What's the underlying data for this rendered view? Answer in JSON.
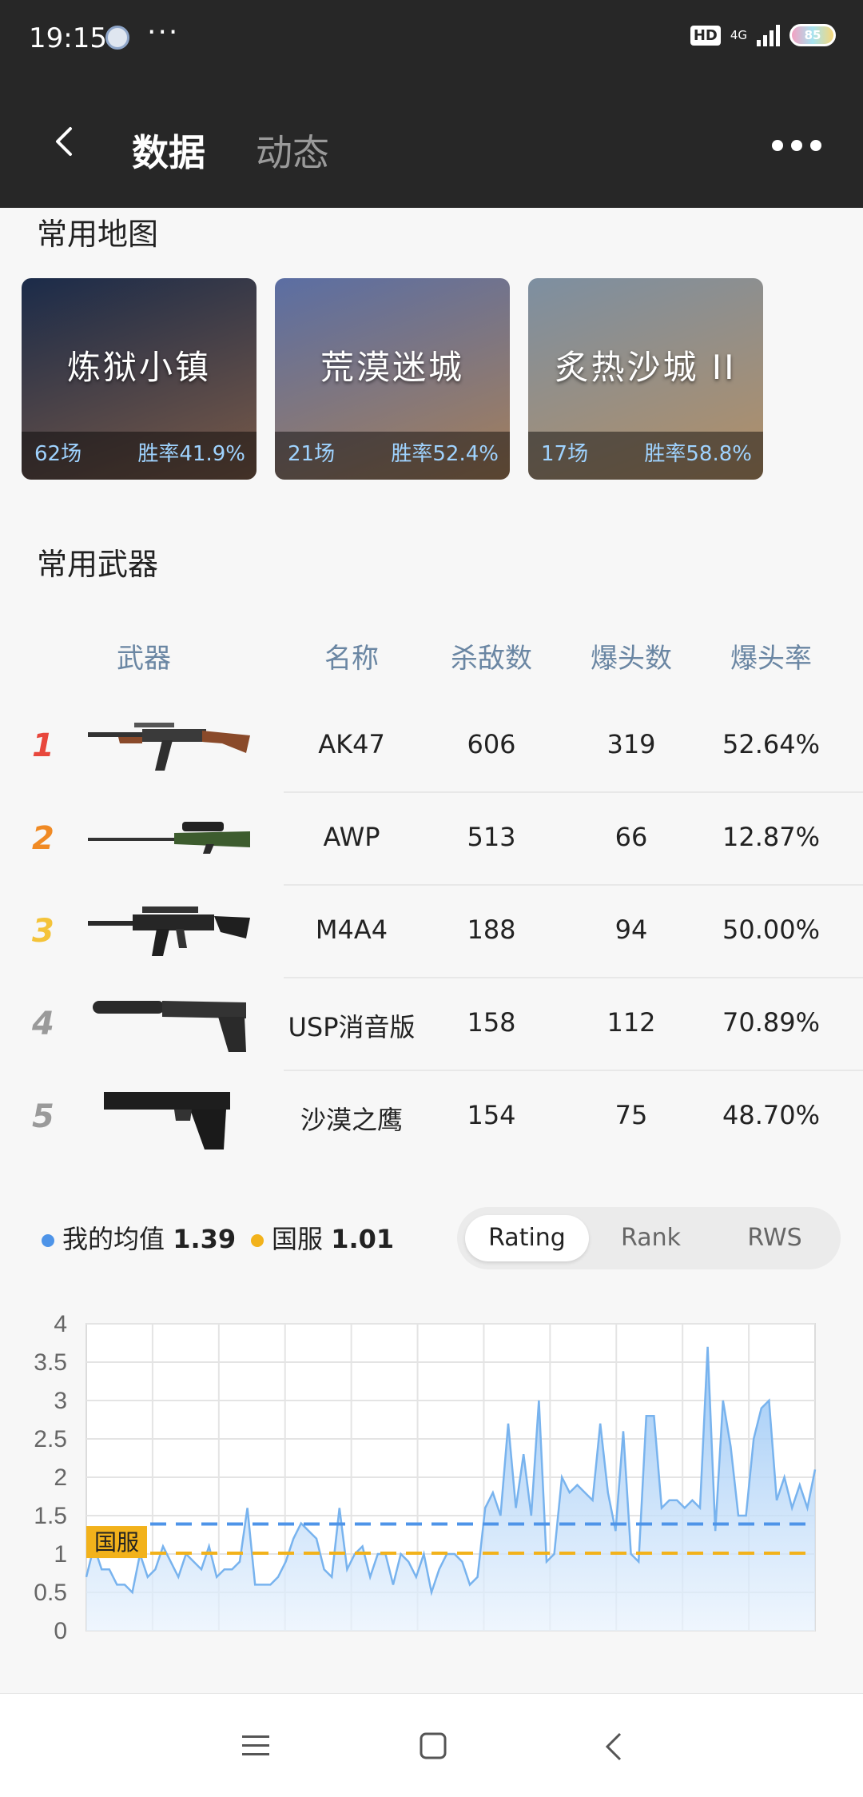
{
  "status_bar": {
    "time": "19:15",
    "more": "···",
    "hd": "HD",
    "network": "4G",
    "battery": "85"
  },
  "header": {
    "tabs": [
      {
        "label": "数据",
        "active": true
      },
      {
        "label": "动态",
        "active": false
      }
    ]
  },
  "maps_section": {
    "title": "常用地图",
    "maps": [
      {
        "name": "炼狱小镇",
        "games": "62场",
        "winrate": "胜率41.9%",
        "colors": [
          "#1b2b49",
          "#7a5a47"
        ]
      },
      {
        "name": "荒漠迷城",
        "games": "21场",
        "winrate": "胜率52.4%",
        "colors": [
          "#5b6ea3",
          "#a57f5a"
        ]
      },
      {
        "name": "炙热沙城 II",
        "games": "17场",
        "winrate": "胜率58.8%",
        "colors": [
          "#7d8fa1",
          "#b28f66"
        ]
      }
    ]
  },
  "weapons_section": {
    "title": "常用武器",
    "headers": {
      "weapon": "武器",
      "name": "名称",
      "kills": "杀敌数",
      "headshots": "爆头数",
      "hs_rate": "爆头率"
    },
    "rows": [
      {
        "rank": "1",
        "name": "AK47",
        "kills": "606",
        "headshots": "319",
        "hs_rate": "52.64%",
        "rank_color": "#e8473c"
      },
      {
        "rank": "2",
        "name": "AWP",
        "kills": "513",
        "headshots": "66",
        "hs_rate": "12.87%",
        "rank_color": "#f08a24"
      },
      {
        "rank": "3",
        "name": "M4A4",
        "kills": "188",
        "headshots": "94",
        "hs_rate": "50.00%",
        "rank_color": "#f4c339"
      },
      {
        "rank": "4",
        "name": "USP消音版",
        "kills": "158",
        "headshots": "112",
        "hs_rate": "70.89%",
        "rank_color": "#9a9a9a"
      },
      {
        "rank": "5",
        "name": "沙漠之鹰",
        "kills": "154",
        "headshots": "75",
        "hs_rate": "48.70%",
        "rank_color": "#9a9a9a"
      }
    ]
  },
  "legend": {
    "mine_label": "我的均值",
    "mine_value": "1.39",
    "mine_color": "#4e94e8",
    "server_label": "国服",
    "server_value": "1.01",
    "server_color": "#f2b21b"
  },
  "segment": {
    "options": [
      "Rating",
      "Rank",
      "RWS"
    ],
    "active": "Rating"
  },
  "chart_data": {
    "type": "area",
    "ylim": [
      0,
      4
    ],
    "yticks": [
      "0",
      "0.5",
      "1",
      "1.5",
      "2",
      "2.5",
      "3",
      "3.5",
      "4"
    ],
    "grid": true,
    "reference_lines": [
      {
        "value": 1.39,
        "color": "#4e94e8"
      },
      {
        "value": 1.01,
        "color": "#f2b21b",
        "label": "国服"
      }
    ],
    "series": [
      {
        "values": [
          0.7,
          1.1,
          0.8,
          0.8,
          0.6,
          0.6,
          0.5,
          1.0,
          0.7,
          0.8,
          1.1,
          0.9,
          0.7,
          1.0,
          0.9,
          0.8,
          1.1,
          0.7,
          0.8,
          0.8,
          0.9,
          1.6,
          0.6,
          0.6,
          0.6,
          0.7,
          0.9,
          1.2,
          1.4,
          1.3,
          1.2,
          0.8,
          0.7,
          1.6,
          0.8,
          1.0,
          1.1,
          0.7,
          1.0,
          1.0,
          0.6,
          1.0,
          0.9,
          0.7,
          1.0,
          0.5,
          0.8,
          1.0,
          1.0,
          0.9,
          0.6,
          0.7,
          1.6,
          1.8,
          1.5,
          2.7,
          1.6,
          2.3,
          1.5,
          3.0,
          0.9,
          1.0,
          2.0,
          1.8,
          1.9,
          1.8,
          1.7,
          2.7,
          1.8,
          1.3,
          2.6,
          1.0,
          0.9,
          2.8,
          2.8,
          1.6,
          1.7,
          1.7,
          1.6,
          1.7,
          1.6,
          3.7,
          1.3,
          3.0,
          2.4,
          1.5,
          1.5,
          2.5,
          2.9,
          3.0,
          1.7,
          2.0,
          1.6,
          1.9,
          1.6,
          2.1
        ]
      }
    ]
  }
}
